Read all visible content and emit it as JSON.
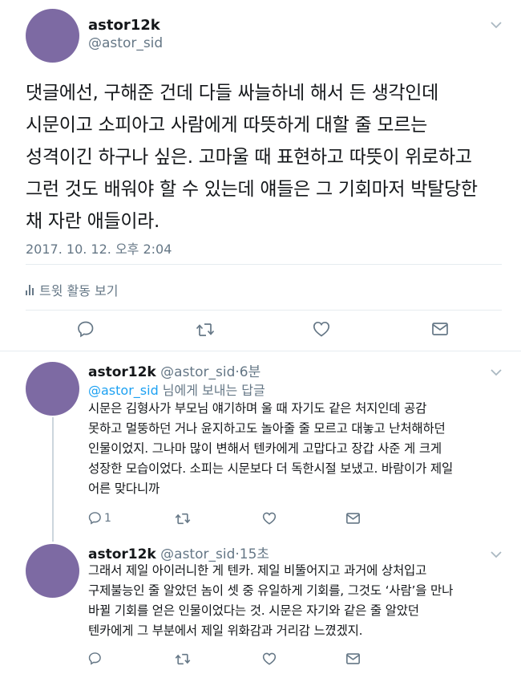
{
  "main_tweet": {
    "display_name": "astor12k",
    "handle": "@astor_sid",
    "text_lines": [
      "댓글에선, 구해준 건데 다들 싸늘하네 해서 든 생각인데",
      "시문이고 소피아고 사람에게 따뜻하게 대할 줄 모르는",
      "성격이긴 하구나 싶은. 고마울 때 표현하고 따뜻이 위로하고",
      "그런 것도 배워야 할 수 있는데 얘들은 그 기회마저 박탈당한",
      "채 자란 애들이라."
    ],
    "timestamp": "2017. 10. 12. 오후 2:04",
    "activity_label": "트윗 활동 보기"
  },
  "replies": [
    {
      "display_name": "astor12k",
      "handle": "@astor_sid",
      "time": "6분",
      "replying_to_handle": "@astor_sid",
      "replying_to_suffix": " 님에게 보내는 답글",
      "text_lines": [
        "시문은 김형사가 부모님 얘기하며 울 때 자기도 같은 처지인데 공감",
        "못하고 멀뚱하던 거나 윤지하고도 놀아줄 줄 모르고 대놓고 난처해하던",
        "인물이었지. 그나마 많이 변해서 텐카에게 고맙다고 장갑 사준 게 크게",
        "성장한 모습이었다. 소피는 시문보다 더 독한시절 보냈고. 바람이가 제일",
        "어른 맞다니까"
      ],
      "reply_count": "1"
    },
    {
      "display_name": "astor12k",
      "handle": "@astor_sid",
      "time": "15초",
      "text_lines": [
        "그래서 제일 아이러니한 게 텐카. 제일 비뚤어지고 과거에 상처입고",
        "구제불능인 줄 알았던 놈이 셋 중 유일하게 기회를, 그것도 ‘사람’을 만나",
        "바뀔 기회를 얻은 인물이었다는 것. 시문은 자기와 같은 줄 알았던",
        "텐카에게 그 부분에서 제일 위화감과 거리감 느꼈겠지."
      ]
    }
  ],
  "icons": [
    "reply-icon",
    "retweet-icon",
    "like-icon",
    "dm-icon",
    "chevron-down-icon",
    "activity-icon"
  ],
  "colors": {
    "avatar": "#7d6aa3",
    "link": "#1da1f2",
    "muted": "#657786",
    "divider": "#e6ecf0"
  }
}
